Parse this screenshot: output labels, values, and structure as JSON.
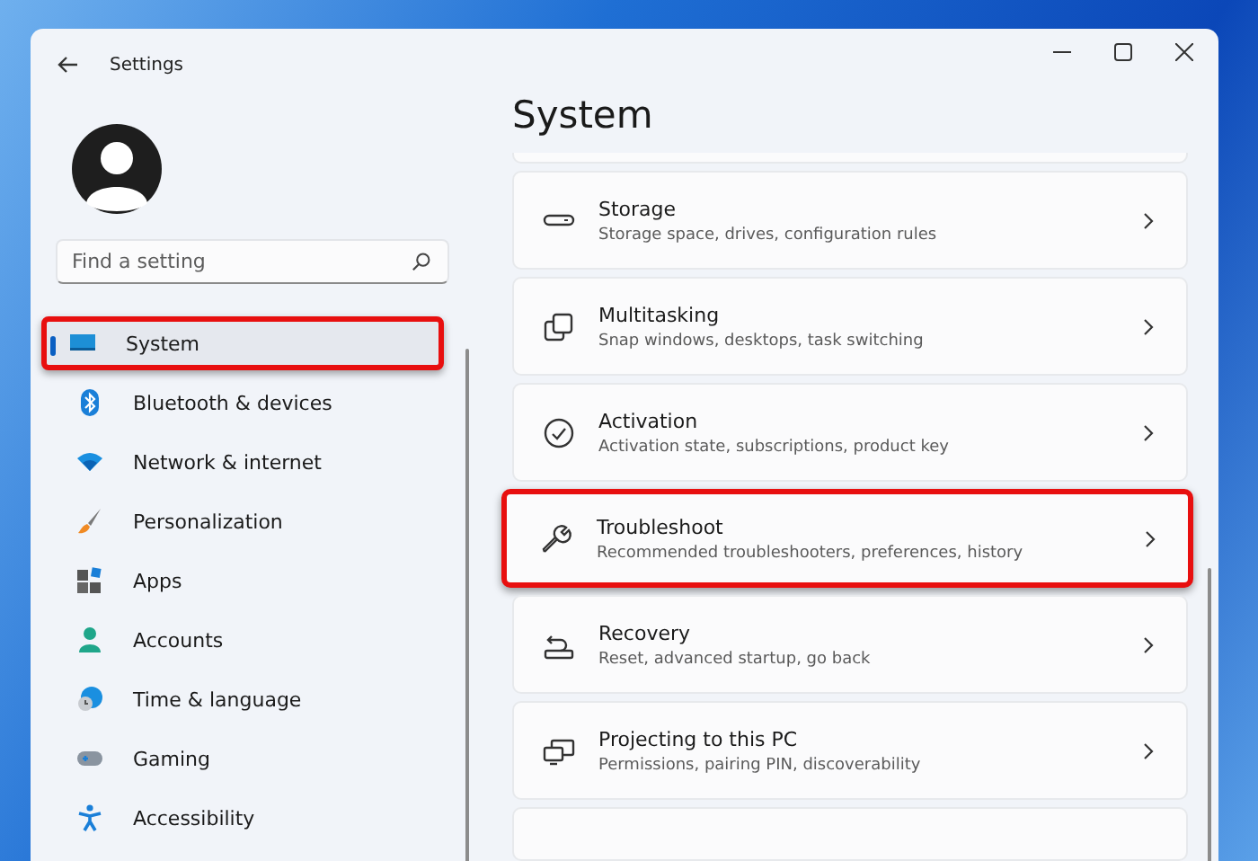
{
  "window": {
    "title": "Settings"
  },
  "search": {
    "placeholder": "Find a setting"
  },
  "nav": [
    {
      "label": "System",
      "kind": "system",
      "selected": true,
      "highlighted": true
    },
    {
      "label": "Bluetooth & devices",
      "kind": "bluetooth",
      "selected": false,
      "highlighted": false
    },
    {
      "label": "Network & internet",
      "kind": "wifi",
      "selected": false,
      "highlighted": false
    },
    {
      "label": "Personalization",
      "kind": "brush",
      "selected": false,
      "highlighted": false
    },
    {
      "label": "Apps",
      "kind": "apps",
      "selected": false,
      "highlighted": false
    },
    {
      "label": "Accounts",
      "kind": "person",
      "selected": false,
      "highlighted": false
    },
    {
      "label": "Time & language",
      "kind": "clock",
      "selected": false,
      "highlighted": false
    },
    {
      "label": "Gaming",
      "kind": "gamepad",
      "selected": false,
      "highlighted": false
    },
    {
      "label": "Accessibility",
      "kind": "accessibility",
      "selected": false,
      "highlighted": false
    }
  ],
  "page": {
    "title": "System"
  },
  "cards": [
    {
      "title": "Storage",
      "subtitle": "Storage space, drives, configuration rules",
      "kind": "drive",
      "highlighted": false
    },
    {
      "title": "Multitasking",
      "subtitle": "Snap windows, desktops, task switching",
      "kind": "windows",
      "highlighted": false
    },
    {
      "title": "Activation",
      "subtitle": "Activation state, subscriptions, product key",
      "kind": "check",
      "highlighted": false
    },
    {
      "title": "Troubleshoot",
      "subtitle": "Recommended troubleshooters, preferences, history",
      "kind": "wrench",
      "highlighted": true
    },
    {
      "title": "Recovery",
      "subtitle": "Reset, advanced startup, go back",
      "kind": "recovery",
      "highlighted": false
    },
    {
      "title": "Projecting to this PC",
      "subtitle": "Permissions, pairing PIN, discoverability",
      "kind": "project",
      "highlighted": false
    }
  ]
}
